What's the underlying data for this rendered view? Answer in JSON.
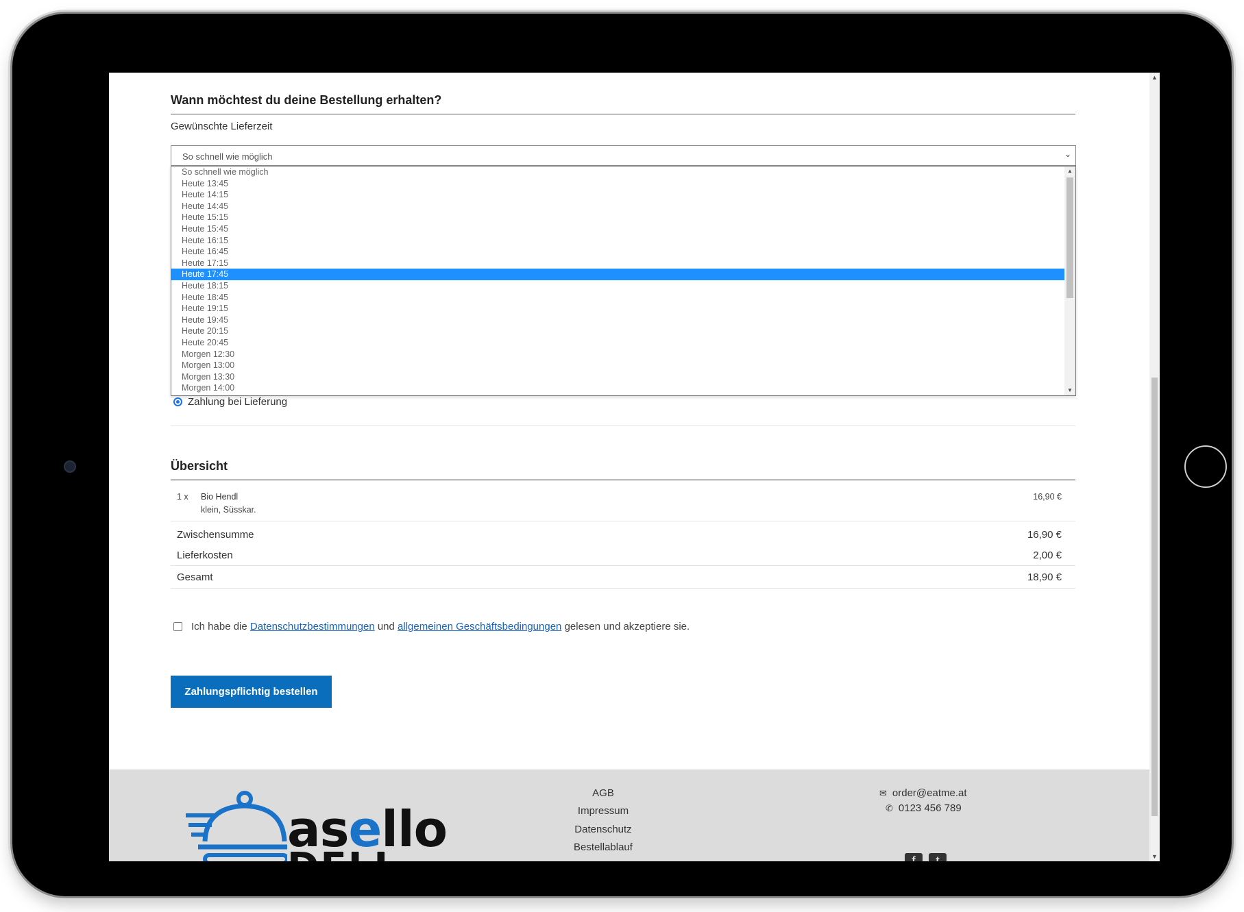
{
  "delivery": {
    "section_title": "Wann möchtest du deine Bestellung erhalten?",
    "time_label": "Gewünschte Lieferzeit",
    "selected_value": "So schnell wie möglich",
    "options": [
      "So schnell wie möglich",
      "Heute 13:45",
      "Heute 14:15",
      "Heute 14:45",
      "Heute 15:15",
      "Heute 15:45",
      "Heute 16:15",
      "Heute 16:45",
      "Heute 17:15",
      "Heute 17:45",
      "Heute 18:15",
      "Heute 18:45",
      "Heute 19:15",
      "Heute 19:45",
      "Heute 20:15",
      "Heute 20:45",
      "Morgen 12:30",
      "Morgen 13:00",
      "Morgen 13:30",
      "Morgen 14:00"
    ],
    "highlighted_option": "Heute 17:45"
  },
  "payment": {
    "option_label": "Zahlung bei Lieferung",
    "selected": true
  },
  "overview": {
    "section_title": "Übersicht",
    "items": [
      {
        "qty": "1 x",
        "name": "Bio Hendl",
        "options": "klein, Süsskar.",
        "price": "16,90 €"
      }
    ],
    "subtotal_label": "Zwischensumme",
    "subtotal_value": "16,90 €",
    "delivery_label": "Lieferkosten",
    "delivery_value": "2,00 €",
    "total_label": "Gesamt",
    "total_value": "18,90 €"
  },
  "terms": {
    "prefix": "Ich habe die",
    "privacy_link": "Datenschutzbestimmungen",
    "middle": "und",
    "terms_link": "allgemeinen Geschäftsbedingungen",
    "suffix": "gelesen und akzeptiere sie.",
    "checked": false
  },
  "order_button": "Zahlungspflichtig bestellen",
  "footer": {
    "logo_text_a": "as",
    "logo_text_e": "e",
    "logo_text_b": "llo",
    "logo_sub": "DELI",
    "links": [
      "AGB",
      "Impressum",
      "Datenschutz",
      "Bestellablauf"
    ],
    "email": "order@eatme.at",
    "phone": "0123 456 789",
    "icons": [
      "envelope-icon",
      "phone-icon",
      "facebook-icon",
      "twitter-icon"
    ]
  },
  "colors": {
    "accent": "#0a6ebd",
    "highlight": "#1e90ff",
    "link": "#1565c0",
    "footer_bg": "#dcdcdc"
  }
}
